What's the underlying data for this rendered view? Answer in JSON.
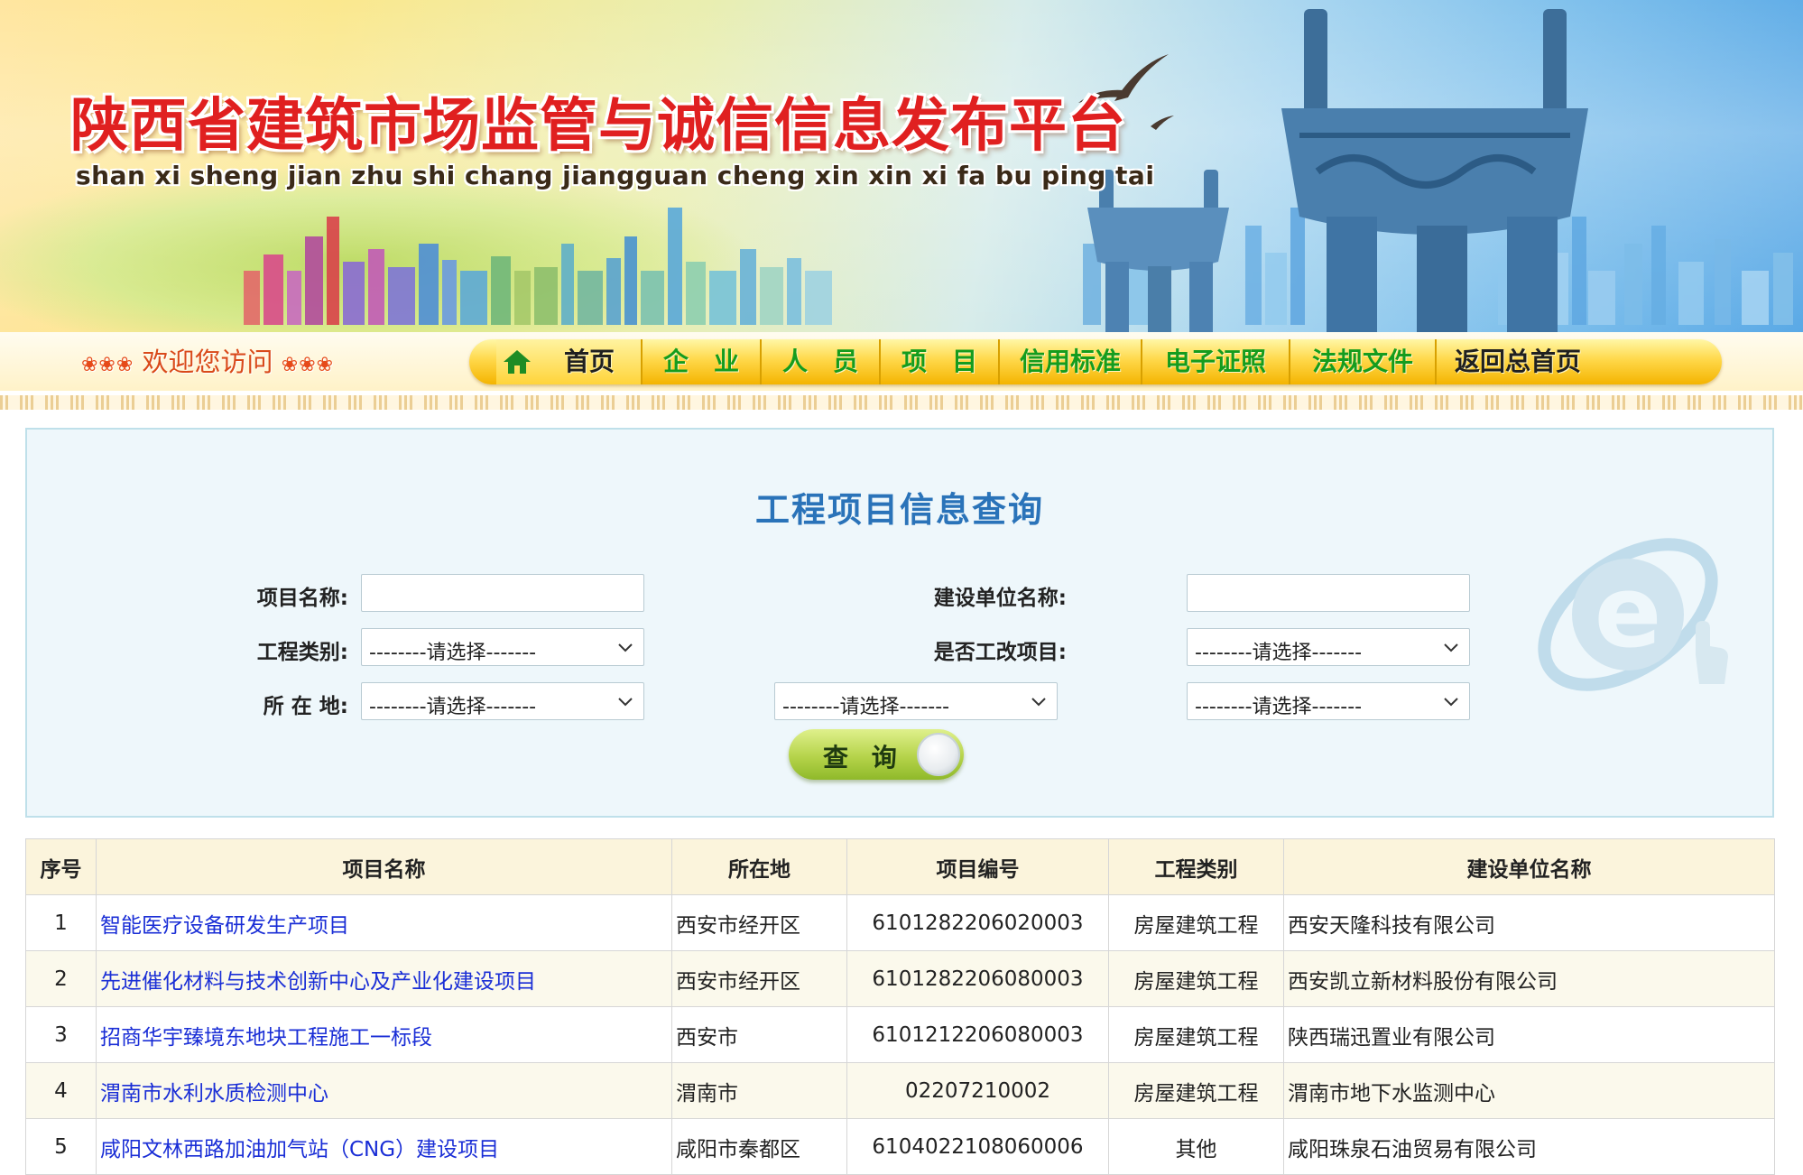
{
  "header": {
    "title": "陕西省建筑市场监管与诚信信息发布平台",
    "pinyin": "shan xi sheng jian zhu shi chang jiangguan cheng xin xin xi fa bu ping tai"
  },
  "welcome": {
    "dots": "❀❀❀",
    "text": "欢迎您访问"
  },
  "nav": {
    "items": [
      "首页",
      "企　业",
      "人　员",
      "项　目",
      "信用标准",
      "电子证照",
      "法规文件",
      "返回总首页"
    ]
  },
  "search": {
    "title": "工程项目信息查询",
    "labels": {
      "project_name": "项目名称:",
      "builder_name": "建设单位名称:",
      "project_type": "工程类别:",
      "renovation": "是否工改项目:",
      "location": "所 在 地:"
    },
    "project_name_value": "",
    "builder_name_value": "",
    "select_placeholder": "--------请选择-------",
    "button_label": "查 询"
  },
  "table": {
    "columns": [
      "序号",
      "项目名称",
      "所在地",
      "项目编号",
      "工程类别",
      "建设单位名称"
    ],
    "rows": [
      {
        "no": "1",
        "name": "智能医疗设备研发生产项目",
        "location": "西安市经开区",
        "code": "6101282206020003",
        "type": "房屋建筑工程",
        "builder": "西安天隆科技有限公司"
      },
      {
        "no": "2",
        "name": "先进催化材料与技术创新中心及产业化建设项目",
        "location": "西安市经开区",
        "code": "6101282206080003",
        "type": "房屋建筑工程",
        "builder": "西安凯立新材料股份有限公司"
      },
      {
        "no": "3",
        "name": "招商华宇臻境东地块工程施工一标段",
        "location": "西安市",
        "code": "6101212206080003",
        "type": "房屋建筑工程",
        "builder": "陕西瑞迅置业有限公司"
      },
      {
        "no": "4",
        "name": "渭南市水利水质检测中心",
        "location": "渭南市",
        "code": "02207210002",
        "type": "房屋建筑工程",
        "builder": "渭南市地下水监测中心"
      },
      {
        "no": "5",
        "name": "咸阳文林西路加油加气站（CNG）建设项目",
        "location": "咸阳市秦都区",
        "code": "6104022108060006",
        "type": "其他",
        "builder": "咸阳珠泉石油贸易有限公司"
      }
    ]
  },
  "colors": {
    "title_red": "#e02020",
    "nav_green": "#159c1e",
    "panel_title_blue": "#2a73b9",
    "link_blue": "#1a2ed6",
    "button_green": "#b5d34a"
  }
}
